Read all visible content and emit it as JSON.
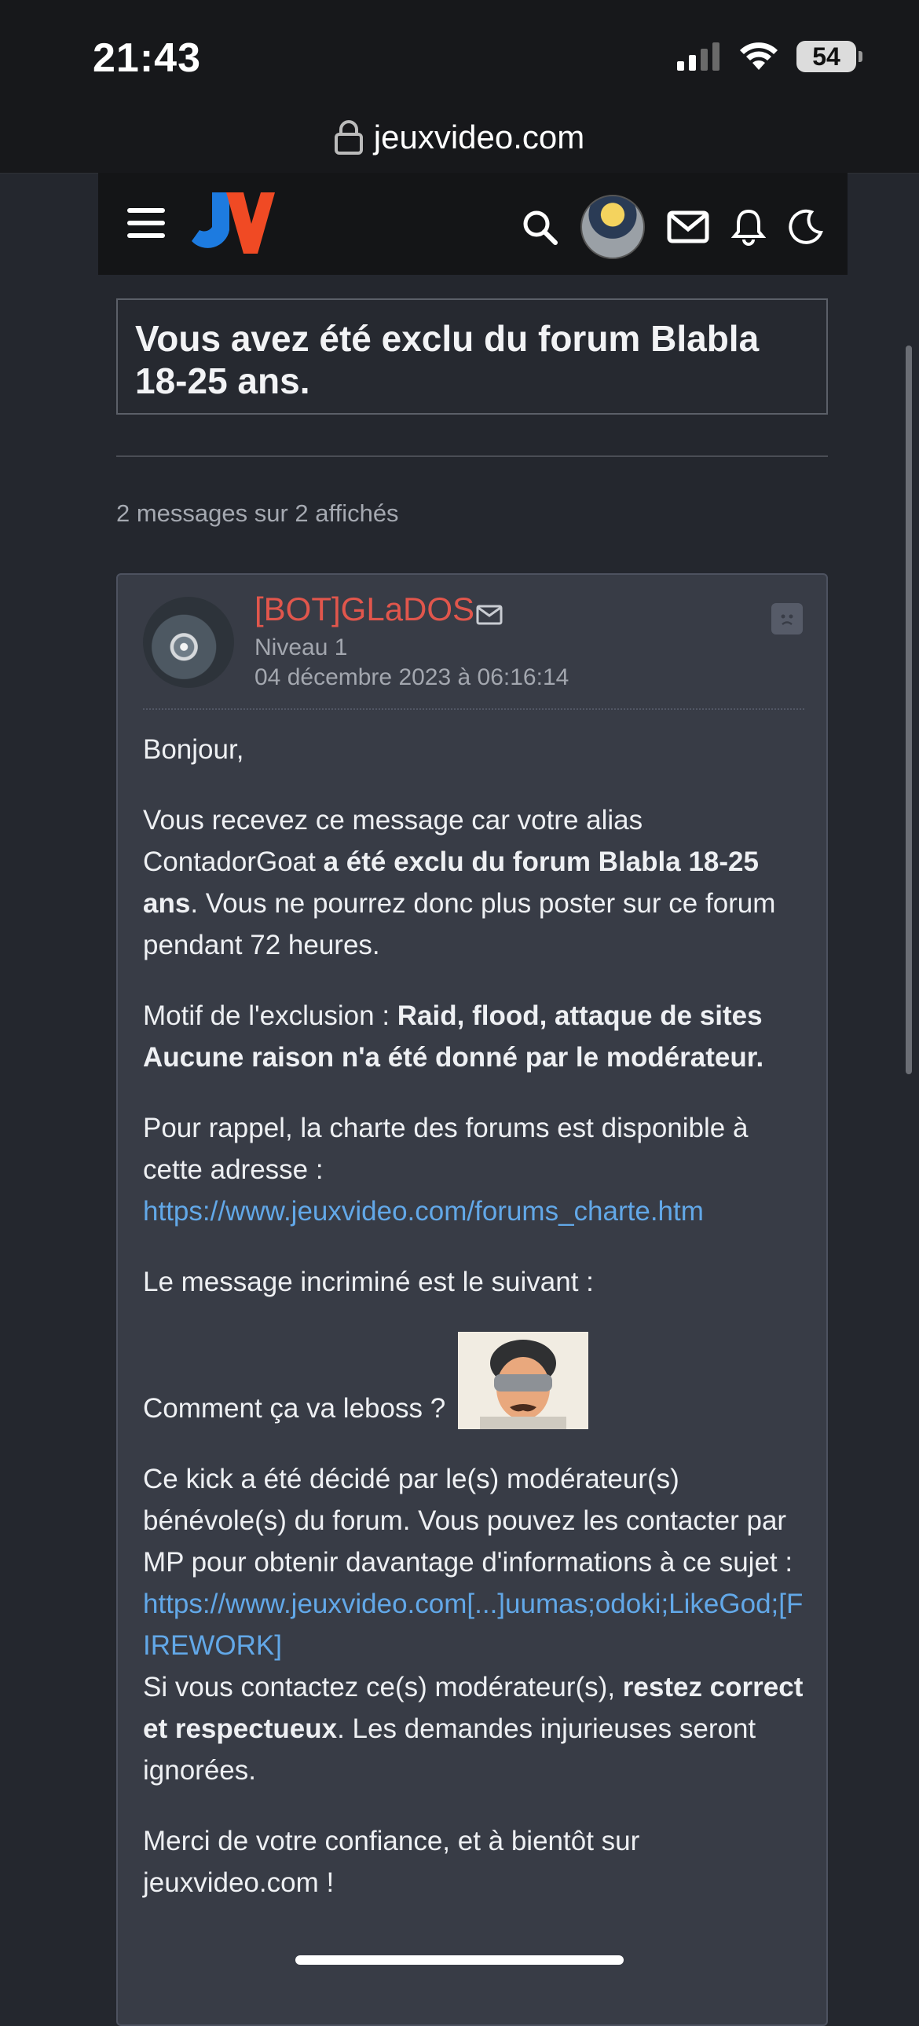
{
  "status_bar": {
    "time": "21:43",
    "battery": "54"
  },
  "browser": {
    "url": "jeuxvideo.com"
  },
  "header": {
    "logo": "JV"
  },
  "topic": {
    "title": "Vous avez été exclu du forum Blabla 18-25 ans.",
    "message_count": "2 messages sur 2 affichés"
  },
  "message": {
    "author": "[BOT]GLaDOS",
    "level": "Niveau 1",
    "date": "04 décembre 2023 à 06:16:14",
    "greeting": "Bonjour,",
    "p1_a": "Vous recevez ce message car votre alias ContadorGoat ",
    "p1_b": "a été exclu du forum Blabla 18-25 ans",
    "p1_c": ". Vous ne pourrez donc plus poster sur ce forum pendant 72 heures.",
    "p2_a": "Motif de l'exclusion : ",
    "p2_b": "Raid, flood, attaque de sites",
    "p2_c": "Aucune raison n'a été donné par le modérateur.",
    "p3_a": "Pour rappel, la charte des forums est disponible à cette adresse :",
    "charter_link": "https://www.jeuxvideo.com/forums_charte.htm",
    "p4": "Le message incriminé est le suivant :",
    "quoted": "Comment ça va leboss ?",
    "p5_a": "Ce kick a été décidé par le(s) modérateur(s) bénévole(s) du forum. Vous pouvez les contacter par MP pour obtenir davantage d'informations à ce sujet :",
    "mp_link": "https://www.jeuxvideo.com[...]uumas;odoki;LikeGod;[FIREWORK]",
    "p6_a": "Si vous contactez ce(s) modérateur(s), ",
    "p6_b": "restez correct et respectueux",
    "p6_c": ". Les demandes injurieuses seront ignorées.",
    "p7": "Merci de votre confiance, et à bientôt sur jeuxvideo.com !"
  }
}
